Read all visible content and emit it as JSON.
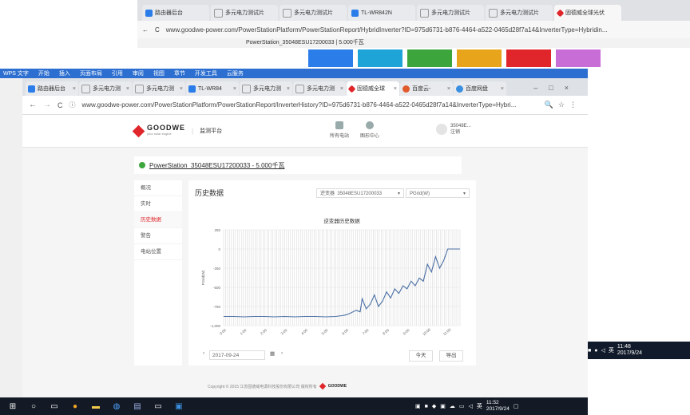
{
  "bg_browser": {
    "tabs": [
      "路由器后台",
      "多元电力测试片",
      "多元电力测试片",
      "TL-WR842N",
      "多元电力测试片",
      "多元电力测试片",
      "固德威全球光伏"
    ],
    "url": "www.goodwe-power.com/PowerStationPlatform/PowerStationReport/HybridInverter?ID=975d6731-b876-4464-a522-0465d28f7a14&InverterType=Hybridin...",
    "strip_text": "PowerStation_35048ESU17200033 | 5.000千瓦"
  },
  "wps": {
    "title": "WPS 文字",
    "menus": [
      "开始",
      "插入",
      "页面布局",
      "引用",
      "审阅",
      "视图",
      "章节",
      "开发工具",
      "云服务"
    ]
  },
  "browser": {
    "tabs": [
      "路由器后台",
      "多元电力测",
      "多元电力测",
      "TL-WR84",
      "多元电力测",
      "多元电力测",
      "固德威全球",
      "百度云-",
      "百度网盘"
    ],
    "url": "www.goodwe-power.com/PowerStationPlatform/PowerStationReport/InverterHistory?ID=975d6731-b876-4464-a522-0465d28f7a14&InverterType=Hybri..."
  },
  "site": {
    "brand": "GOODWE",
    "brand_sub": "your solar engine",
    "platform": "监测平台",
    "nav": [
      "所有电站",
      "图形中心"
    ],
    "user_id": "35048E...",
    "user_action": "注销"
  },
  "station": {
    "name": "PowerStation_35048ESU17200033 - 5.000千瓦"
  },
  "sidebar": {
    "items": [
      "概况",
      "实时",
      "历史数据",
      "警告",
      "电站位置"
    ]
  },
  "content": {
    "title": "历史数据",
    "inverter_label": "逆变器",
    "inverter_value": "35048ESU17200033",
    "param_value": "PGrid(W)",
    "date_value": "2017-09-24",
    "today_btn": "今天",
    "export_btn": "导出"
  },
  "chart_data": {
    "type": "line",
    "title": "逆变器历史数据",
    "ylabel": "PGrid(W)",
    "ylim": [
      -1000,
      250
    ],
    "yticks": [
      "250",
      "0",
      "-250",
      "-500",
      "-750",
      "-1,000"
    ],
    "xticks": [
      "0:00",
      "1:00",
      "2:00",
      "3:00",
      "4:00",
      "5:00",
      "6:00",
      "7:00",
      "8:00",
      "9:00",
      "10:00",
      "11:00"
    ],
    "x": [
      0,
      0.5,
      1,
      1.5,
      2,
      2.5,
      3,
      3.5,
      4,
      4.5,
      5,
      5.5,
      5.8,
      6,
      6.2,
      6.5,
      6.7,
      6.8,
      7,
      7.2,
      7.4,
      7.6,
      7.8,
      8,
      8.2,
      8.4,
      8.6,
      8.8,
      9,
      9.2,
      9.4,
      9.6,
      9.8,
      10,
      10.2,
      10.4,
      10.6,
      10.8,
      11,
      11.2,
      11.4,
      11.6
    ],
    "y": [
      -880,
      -880,
      -885,
      -880,
      -880,
      -885,
      -880,
      -885,
      -880,
      -880,
      -885,
      -880,
      -870,
      -860,
      -840,
      -800,
      -820,
      -650,
      -780,
      -720,
      -600,
      -750,
      -680,
      -560,
      -640,
      -520,
      -580,
      -480,
      -520,
      -420,
      -480,
      -380,
      -420,
      -200,
      -300,
      -100,
      -250,
      -150,
      0,
      0,
      0,
      0
    ]
  },
  "footer": {
    "copyright": "Copyright © 2015 江苏固德威电源科技股份有限公司 版权所有"
  },
  "taskbar": {
    "time": "11:52",
    "date": "2017/9/24",
    "ime": "英",
    "right_time": "11:48",
    "right_date": "2017/9/24",
    "right_ime": "英"
  }
}
